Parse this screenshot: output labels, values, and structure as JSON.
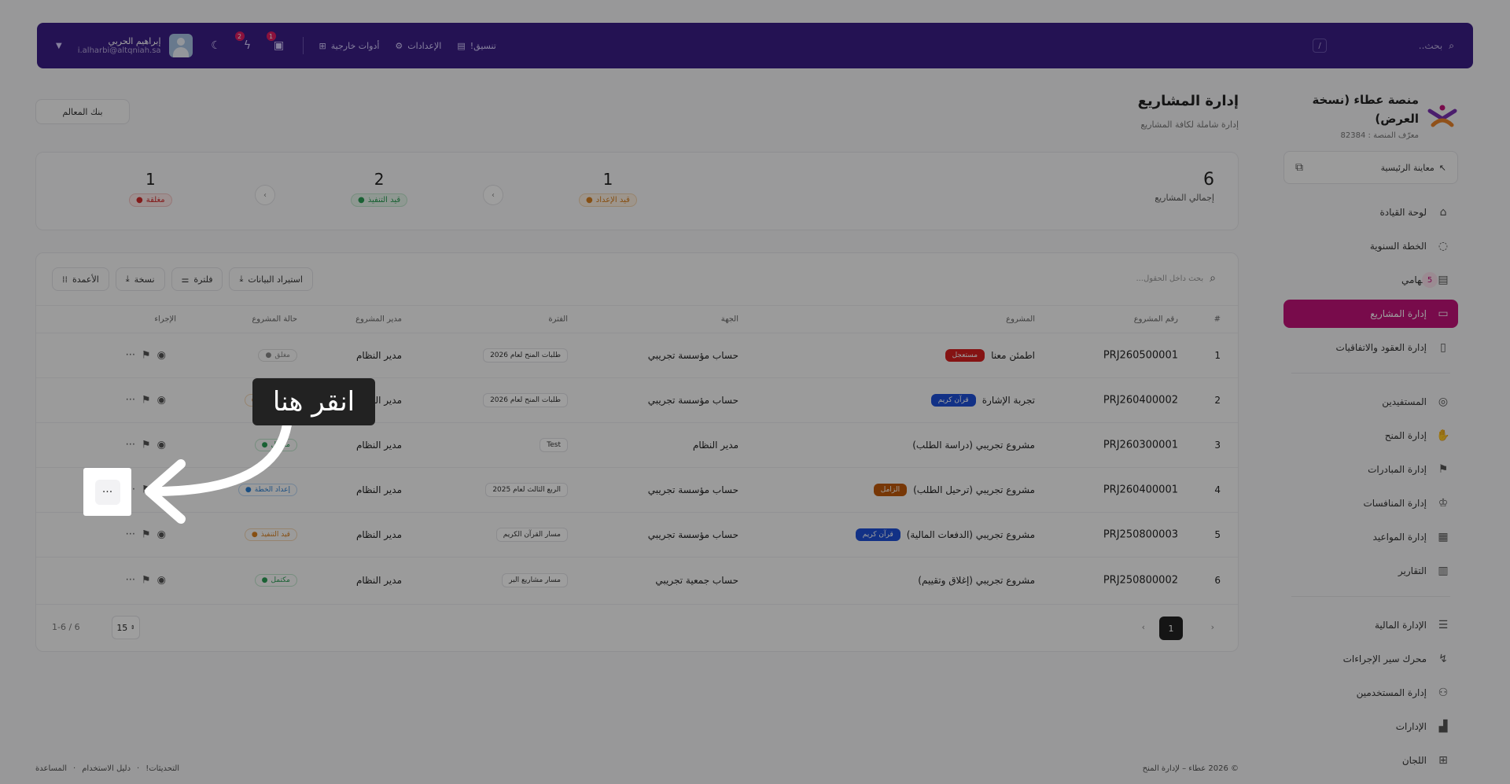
{
  "topbar": {
    "search_placeholder": "بحث..",
    "slash": "/",
    "coordinate": "تنسيق!",
    "settings": "الإعدادات",
    "external_tools": "أدوات خارجية",
    "inbox_badge": "1",
    "bolt_badge": "2",
    "user_name": "إبراهيم الحربي",
    "user_email": "i.alharbi@altqniah.sa"
  },
  "sidebar": {
    "brand_title": "منصة عطاء (نسخة العرض)",
    "brand_sub": "معرّف المنصة : 82384",
    "preview": "معاينة الرئيسية",
    "items": [
      {
        "label": "لوحة القيادة"
      },
      {
        "label": "الخطة السنوية"
      },
      {
        "label": "مهامي",
        "count": "5"
      },
      {
        "label": "إدارة المشاريع"
      },
      {
        "label": "إدارة العقود والاتفاقيات"
      },
      {
        "label": "المستفيدين"
      },
      {
        "label": "إدارة المنح"
      },
      {
        "label": "إدارة المبادرات"
      },
      {
        "label": "إدارة المنافسات"
      },
      {
        "label": "إدارة المواعيد"
      },
      {
        "label": "التقارير"
      },
      {
        "label": "الإدارة المالية"
      },
      {
        "label": "محرك سير الإجراءات"
      },
      {
        "label": "إدارة المستخدمين"
      },
      {
        "label": "الإدارات"
      },
      {
        "label": "اللجان"
      }
    ]
  },
  "page": {
    "title": "إدارة المشاريع",
    "subtitle": "إدارة شاملة لكافة المشاريع",
    "milestones_btn": "بنك المعالم"
  },
  "stats": {
    "total": "6",
    "total_label": "إجمالي المشاريع",
    "prep": "1",
    "prep_label": "قيد الإعداد",
    "exec": "2",
    "exec_label": "قيد التنفيذ",
    "closed": "1",
    "closed_label": "مغلقة"
  },
  "toolbar": {
    "search_placeholder": "بحث داخل الحقول...",
    "import": "استيراد البيانات",
    "filter": "فلترة",
    "copy": "نسخة",
    "columns": "الأعمدة"
  },
  "table": {
    "headers": {
      "idx": "#",
      "code": "رقم المشروع",
      "project": "المشروع",
      "entity": "الجهة",
      "period": "الفترة",
      "manager": "مدير المشروع",
      "status": "حالة المشروع",
      "action": "الإجراء"
    },
    "rows": [
      {
        "idx": "1",
        "code": "PRJ260500001",
        "project": "اطمئن معنا",
        "tag": "مستعجل",
        "entity": "حساب مؤسسة تجريبي",
        "period": "طلبات المنح لعام 2026",
        "manager": "مدير النظام",
        "status": "مغلق"
      },
      {
        "idx": "2",
        "code": "PRJ260400002",
        "project": "تجربة الإشارة",
        "tag": "قرآن كريم",
        "entity": "حساب مؤسسة تجريبي",
        "period": "طلبات المنح لعام 2026",
        "manager": "مدير النظام",
        "status": "قيد التنفيذ"
      },
      {
        "idx": "3",
        "code": "PRJ260300001",
        "project": "مشروع تجريبي (دراسة الطلب)",
        "tag": "",
        "entity": "مدير النظام",
        "period": "Test",
        "manager": "مدير النظام",
        "status": "مكتمل"
      },
      {
        "idx": "4",
        "code": "PRJ260400001",
        "project": "مشروع تجريبي (ترحيل الطلب)",
        "tag": "الزامل",
        "entity": "حساب مؤسسة تجريبي",
        "period": "الربع الثالث لعام 2025",
        "manager": "مدير النظام",
        "status": "إعداد الخطة"
      },
      {
        "idx": "5",
        "code": "PRJ250800003",
        "project": "مشروع تجريبي (الدفعات المالية)",
        "tag": "قرآن كريم",
        "entity": "حساب مؤسسة تجريبي",
        "period": "مسار القرآن الكريم",
        "manager": "مدير النظام",
        "status": "قيد التنفيذ"
      },
      {
        "idx": "6",
        "code": "PRJ250800002",
        "project": "مشروع تجريبي (إغلاق وتقييم)",
        "tag": "",
        "entity": "حساب جمعية تجريبي",
        "period": "مسار مشاريع البر",
        "manager": "مدير النظام",
        "status": "مكتمل"
      }
    ]
  },
  "pager": {
    "current": "1",
    "page_size": "15",
    "info": "1-6 / 6"
  },
  "footer": {
    "updates": "التحديثات!",
    "guide": "دليل الاستخدام",
    "help": "المساعدة",
    "copyright": "© 2026 عطاء – لإدارة المنح"
  },
  "overlay": {
    "callout": "انقر هنا",
    "dots": "···"
  },
  "colors": {
    "topbar": "#3b1d86",
    "accent": "#c2127a",
    "urgent": "#d71f1f",
    "quran": "#1d4fd8",
    "zamil": "#c05a0a"
  }
}
